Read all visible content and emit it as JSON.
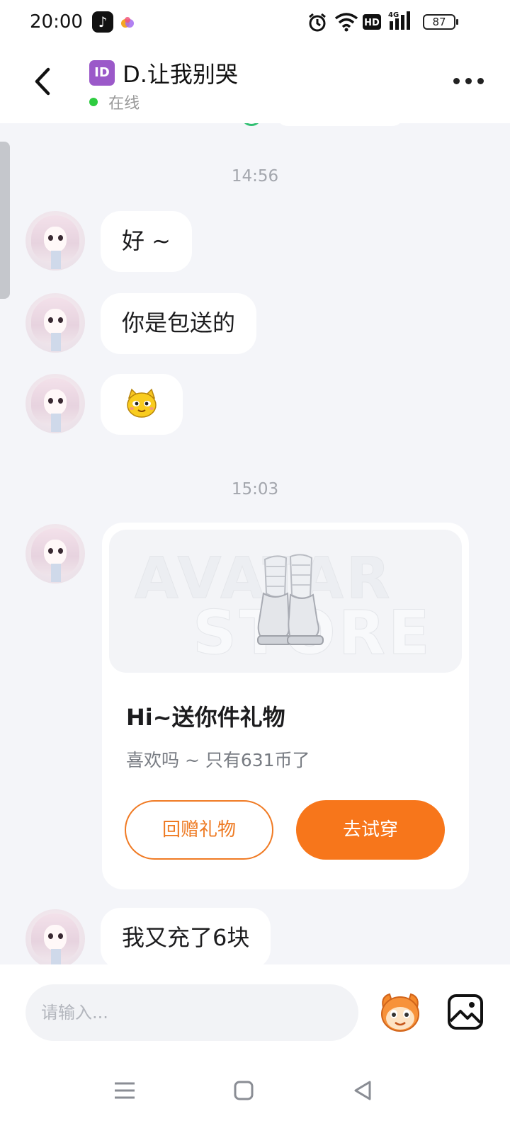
{
  "status_bar": {
    "time": "20:00",
    "battery": "87",
    "icons": [
      "tiktok-icon",
      "app-blob-icon",
      "alarm-icon",
      "wifi-icon",
      "hd-icon",
      "signal-4g-icon",
      "battery-icon"
    ]
  },
  "header": {
    "badge": "ID",
    "name": "D.让我别哭",
    "status": "在线"
  },
  "messages": [
    {
      "type": "timestamp",
      "text": "14:56"
    },
    {
      "type": "text",
      "text": "好 ~"
    },
    {
      "type": "text",
      "text": "你是包送的"
    },
    {
      "type": "emoji",
      "emoji": "yellow-cat-emoji"
    },
    {
      "type": "timestamp",
      "text": "15:03"
    },
    {
      "type": "text",
      "text": "我又充了6块"
    }
  ],
  "gift_card": {
    "image_text_top": "AVATAR",
    "image_text_bottom": "STORE",
    "title": "Hi~送你件礼物",
    "subtitle": "喜欢吗 ~ 只有631币了",
    "return_gift_label": "回赠礼物",
    "try_on_label": "去试穿"
  },
  "input": {
    "placeholder": "请输入..."
  },
  "colors": {
    "accent": "#f7761b",
    "online": "#2ecc40",
    "background": "#f4f5f9"
  }
}
